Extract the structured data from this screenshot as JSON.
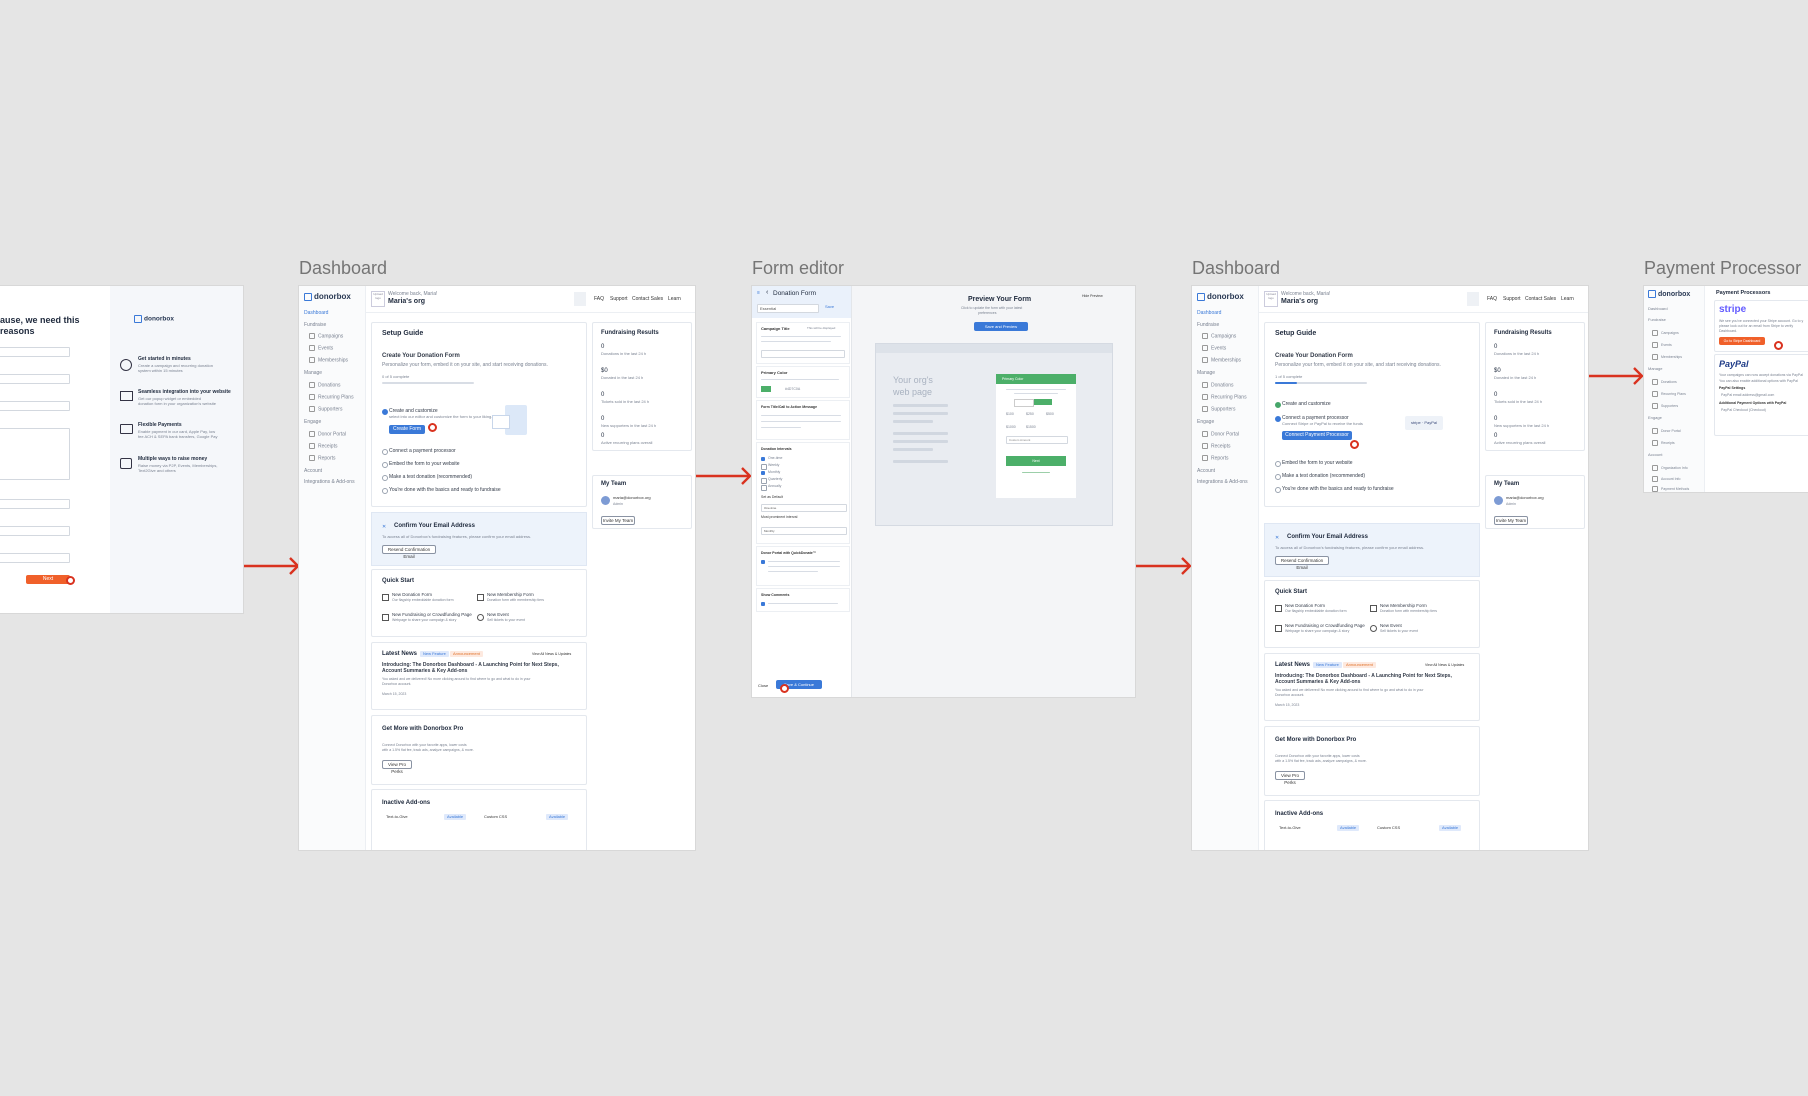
{
  "frames": {
    "frame2_title": "Dashboard",
    "frame3_title": "Form editor",
    "frame4_title": "Dashboard",
    "frame5_title": "Payment Processor"
  },
  "signup": {
    "heading_line1": "ause, we need this",
    "heading_line2": " reasons",
    "brand": "donorbox",
    "submit_label": "Next",
    "features": [
      {
        "title": "Get started in minutes",
        "desc1": "Create a campaign and recurring donation",
        "desc2": "system within 15 minutes"
      },
      {
        "title": "Seamless integration into your website",
        "desc1": "Get our popup widget or embedded",
        "desc2": "donation form in your organization's website"
      },
      {
        "title": "Flexible Payments",
        "desc1": "Enable payment in our card, Apple Pay, low",
        "desc2": "fee ACH & SEPA bank transfers, Google Pay"
      },
      {
        "title": "Multiple ways to raise money",
        "desc1": "Raise money via P2P, Events, Memberships,",
        "desc2": "Text2Give and others"
      }
    ]
  },
  "dashboard": {
    "brand": "donorbox",
    "upload_logo": "Upload logo",
    "welcome": "Welcome back, Maria!",
    "org_name": "Maria's org",
    "top_nav": [
      "FAQ",
      "Support",
      "Contact Sales",
      "Learn"
    ],
    "sidebar": {
      "dashboard": "Dashboard",
      "fundraise": "Fundraise",
      "fundraise_items": [
        "Campaigns",
        "Events",
        "Memberships"
      ],
      "manage": "Manage",
      "manage_items": [
        "Donations",
        "Recurring Plans",
        "Supporters"
      ],
      "engage": "Engage",
      "engage_items": [
        "Donor Portal",
        "Receipts",
        "Reports"
      ],
      "account": "Account",
      "integrations": "Integrations & Add-ons"
    },
    "setup_guide": {
      "title": "Setup Guide",
      "subtitle": "Create Your Donation Form",
      "desc": "Personalize your form, embed it on your site, and start receiving donations.",
      "progress_label": "0 of 5 complete",
      "progress_label_b": "1 of 5 complete",
      "step1": "Create and customize",
      "step1_desc": "select into our editor and customize the form to your liking.",
      "create_form_btn": "Create Form",
      "step2": "Connect a payment processor",
      "step2_desc": "Connect Stripe or PayPal to receive the funds",
      "connect_btn": "Connect Payment Processor",
      "step3": "Embed the form to your website",
      "step4": "Make a test donation (recommended)",
      "step5": "You're done with the basics and ready to fundraise"
    },
    "fundraising": {
      "title": "Fundraising Results",
      "stats": [
        {
          "value": "0",
          "label": "Donations in the last 24 h"
        },
        {
          "value": "$0",
          "label": "Donated in the last 24 h"
        },
        {
          "value": "0",
          "label": "Tickets sold in the last 24 h"
        },
        {
          "value": "0",
          "label": "New supporters in the last 24 h"
        },
        {
          "value": "0",
          "label": "Active recurring plans overall"
        }
      ]
    },
    "team": {
      "title": "My Team",
      "email": "maria@donorbox.org",
      "role": "Admin",
      "invite_btn": "Invite My Team"
    },
    "confirm_email": {
      "title": "Confirm Your Email Address",
      "desc": "To access all of Donorbox's fundraising features, please confirm your email address.",
      "btn": "Resend Confirmation Email"
    },
    "quick_start": {
      "title": "Quick Start",
      "items": [
        {
          "title": "New Donation Form",
          "desc": "Our flagship embeddable donation form"
        },
        {
          "title": "New Membership Form",
          "desc": "Donation form with membership tiers"
        },
        {
          "title": "New Fundraising or Crowdfunding Page",
          "desc": "Webpage to share your campaign & story"
        },
        {
          "title": "New Event",
          "desc": "Sell tickets to your event"
        }
      ]
    },
    "latest_news": {
      "title": "Latest News",
      "badge1": "New Feature",
      "badge2": "Announcement",
      "view_all": "View All News & Updates",
      "headline1": "Introducing: The Donorbox Dashboard - A Launching Point for Next Steps,",
      "headline2": "Account Summaries & Key Add-ons",
      "body1": "You asked and we delivered! No more clicking around to find where to go and what to do in your",
      "body2": "Donorbox account.",
      "date": "March 15, 2023"
    },
    "pro": {
      "title": "Get More with Donorbox Pro",
      "desc1": "Connect Donorbox with your favorite apps, lower costs",
      "desc2": "with a 1.5% flat fee, track ads, analyze campaigns, & more.",
      "btn": "View Pro Perks"
    },
    "addons": {
      "title": "Inactive Add-ons",
      "item1": "Text-to-Give",
      "item2": "Custom CSS",
      "badge": "Available"
    }
  },
  "editor": {
    "back_title": "Donation Form",
    "select_value": "Essential",
    "select_btn": "Save",
    "sections": {
      "campaign_title": "Campaign Title",
      "campaign_hint": "This will be displayed",
      "primary_color": "Primary Color",
      "primary_color_value": "#4D7C0A",
      "cta_message": "Form Title/Call to Action Message",
      "donation_intervals": "Donation Intervals",
      "intervals": [
        "One-time",
        "Weekly",
        "Monthly",
        "Quarterly",
        "Annually"
      ],
      "set_default": "Set as Default",
      "default_value": "One-time",
      "most_prominent": "Most prominent interval",
      "prominent_value": "Monthly",
      "donor_portal": "Donor Portal with QuickDonate™",
      "show_comments": "Show Comments"
    },
    "preview": {
      "title": "Preview Your Form",
      "subtitle1": "Click to update the form with your latest",
      "subtitle2": "preferences",
      "btn": "Save and Preview",
      "hide_preview": "Hide Preview",
      "web_page_line1": "Your org's",
      "web_page_line2": "web page",
      "form_header": "Primary Color",
      "amounts": [
        "$100",
        "$250",
        "$500",
        "$1000",
        "$1500"
      ],
      "custom_amount": "Custom Amount",
      "next_btn": "Next"
    },
    "close": "Close",
    "save_btn": "Save & Continue"
  },
  "payment": {
    "brand": "donorbox",
    "title": "Payment Processors",
    "stripe": "stripe",
    "stripe_desc1": "We see you've connected your Stripe account. Go to y",
    "stripe_desc2": "please look out for an email from Stripe to verify",
    "stripe_desc3": "Dashboard.",
    "stripe_btn": "Go to Stripe Dashboard",
    "paypal": "PayPal",
    "paypal_desc1": "Your campaigns can now accept donations via PayPal",
    "paypal_desc2": "You can also enable additional options with PayPal",
    "paypal_settings": "PayPal Settings",
    "paypal_setting_item": "PayPal email address@gmail.com",
    "additional": "Additional Payment Options with PayPal",
    "checkout": "PayPal Checkout (Checkout)",
    "sidebar": {
      "dashboard": "Dashboard",
      "fundraise": "Fundraise",
      "fundraise_items": [
        "Campaigns",
        "Events",
        "Memberships"
      ],
      "manage": "Manage",
      "manage_items": [
        "Donations",
        "Recurring Plans",
        "Supporters"
      ],
      "engage": "Engage",
      "engage_items": [
        "Donor Portal",
        "Receipts"
      ],
      "account": "Account",
      "account_items": [
        "Organization Info",
        "Account Info",
        "Payment Methods"
      ]
    }
  },
  "colors": {
    "connector": "#d9321f",
    "primary_blue": "#3a79d8",
    "orange": "#f0602a",
    "canvas": "#e5e5e5",
    "form_green": "#4caf69"
  }
}
